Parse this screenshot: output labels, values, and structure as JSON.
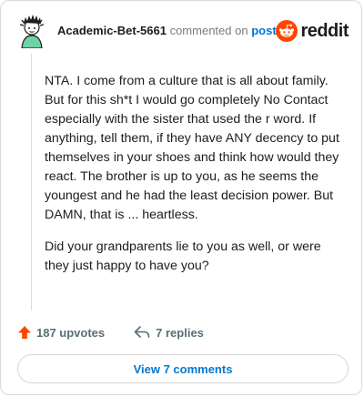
{
  "comment": {
    "username": "Academic-Bet-5661",
    "action_text": "commented on",
    "post_link": "post",
    "paragraphs": [
      "NTA. I come from a culture that is all about family. But for this sh*t I would go completely No Contact especially with the sister that used the r word. If anything, tell them, if they have ANY decency to put themselves in your shoes and think how would they react. The brother is up to you, as he seems the youngest and he had the least decision power. But DAMN, that is ... heartless.",
      "Did your grandparents lie to you as well, or were they just happy to have you?"
    ]
  },
  "brand": {
    "name": "reddit",
    "color": "#ff4500",
    "icon": "reddit-snoo-icon"
  },
  "actions": {
    "upvotes": "187 upvotes",
    "replies": "7 replies",
    "upvote_icon": "upvote-arrow-icon",
    "reply_icon": "reply-arrow-icon",
    "upvote_color": "#ff4500"
  },
  "footer": {
    "view_comments": "View 7 comments",
    "link_color": "#0079d3"
  }
}
